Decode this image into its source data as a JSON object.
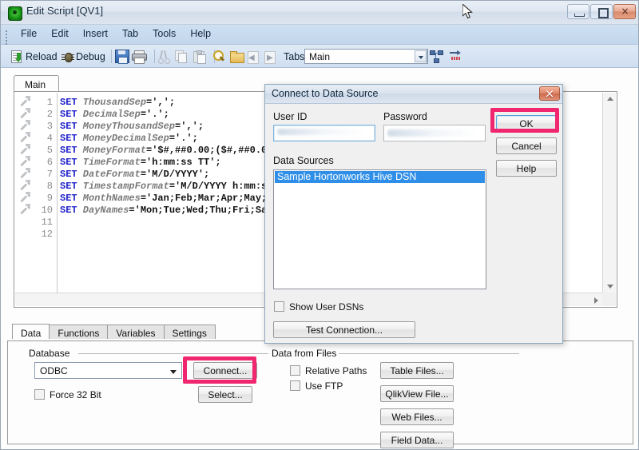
{
  "window": {
    "title": "Edit Script [QV1]",
    "icon": "qlikview-logo-icon",
    "controls": {
      "minimize": "–",
      "maximize": "□",
      "close": "×"
    }
  },
  "menubar": {
    "items": [
      {
        "label": "File"
      },
      {
        "label": "Edit"
      },
      {
        "label": "Insert"
      },
      {
        "label": "Tab"
      },
      {
        "label": "Tools"
      },
      {
        "label": "Help"
      }
    ]
  },
  "toolbar": {
    "reload_label": "Reload",
    "debug_label": "Debug",
    "tabs_label": "Tabs",
    "tabs_combo_value": "Main",
    "icons": [
      "save-icon",
      "print-icon",
      "cut-icon",
      "copy-icon",
      "paste-icon",
      "find-icon",
      "open-folder-icon",
      "previous-tab-icon",
      "next-tab-icon",
      "tab-structure-icon",
      "goto-icon"
    ]
  },
  "script_tabs": [
    {
      "label": "Main",
      "active": true
    }
  ],
  "editor": {
    "lines": [
      {
        "num": "1",
        "kw": "SET",
        "var": " ThousandSep",
        "val": "=',';"
      },
      {
        "num": "2",
        "kw": "SET",
        "var": " DecimalSep",
        "val": "='.';"
      },
      {
        "num": "3",
        "kw": "SET",
        "var": " MoneyThousandSep",
        "val": "=',';"
      },
      {
        "num": "4",
        "kw": "SET",
        "var": " MoneyDecimalSep",
        "val": "='.';"
      },
      {
        "num": "5",
        "kw": "SET",
        "var": " MoneyFormat",
        "val": "='$#,##0.00;($#,##0.0"
      },
      {
        "num": "6",
        "kw": "SET",
        "var": " TimeFormat",
        "val": "='h:mm:ss TT';"
      },
      {
        "num": "7",
        "kw": "SET",
        "var": " DateFormat",
        "val": "='M/D/YYYY';"
      },
      {
        "num": "8",
        "kw": "SET",
        "var": " TimestampFormat",
        "val": "='M/D/YYYY h:mm:s"
      },
      {
        "num": "9",
        "kw": "SET",
        "var": " MonthNames",
        "val": "='Jan;Feb;Mar;Apr;May;"
      },
      {
        "num": "10",
        "kw": "SET",
        "var": " DayNames",
        "val": "='Mon;Tue;Wed;Thu;Fri;Sa"
      },
      {
        "num": "11",
        "kw": "",
        "var": "",
        "val": ""
      },
      {
        "num": "12",
        "kw": "",
        "var": "",
        "val": ""
      }
    ]
  },
  "bottom_tabs": [
    {
      "label": "Data",
      "active": true
    },
    {
      "label": "Functions",
      "active": false
    },
    {
      "label": "Variables",
      "active": false
    },
    {
      "label": "Settings",
      "active": false
    }
  ],
  "database_group": {
    "title": "Database",
    "combo_value": "ODBC",
    "connect_label": "Connect...",
    "select_label": "Select...",
    "force32_label": "Force 32 Bit",
    "force32_checked": false
  },
  "files_group": {
    "title": "Data from Files",
    "relative_paths_label": "Relative Paths",
    "relative_paths_checked": false,
    "use_ftp_label": "Use FTP",
    "use_ftp_checked": false,
    "buttons": [
      {
        "label": "Table Files..."
      },
      {
        "label": "QlikView File..."
      },
      {
        "label": "Web Files..."
      },
      {
        "label": "Field Data..."
      }
    ]
  },
  "dialog": {
    "title": "Connect to Data Source",
    "close_glyph": "×",
    "user_id_label": "User ID",
    "user_id_value": "",
    "password_label": "Password",
    "password_value": "",
    "data_sources_label": "Data Sources",
    "data_sources": [
      {
        "label": "Sample Hortonworks Hive DSN",
        "selected": true
      }
    ],
    "show_user_dsns_label": "Show User DSNs",
    "show_user_dsns_checked": false,
    "test_connection_label": "Test Connection...",
    "ok_label": "OK",
    "cancel_label": "Cancel",
    "help_label": "Help"
  },
  "highlights": {
    "accent_color": "#f0266e",
    "targets": [
      "ok-button",
      "connect-button"
    ]
  }
}
